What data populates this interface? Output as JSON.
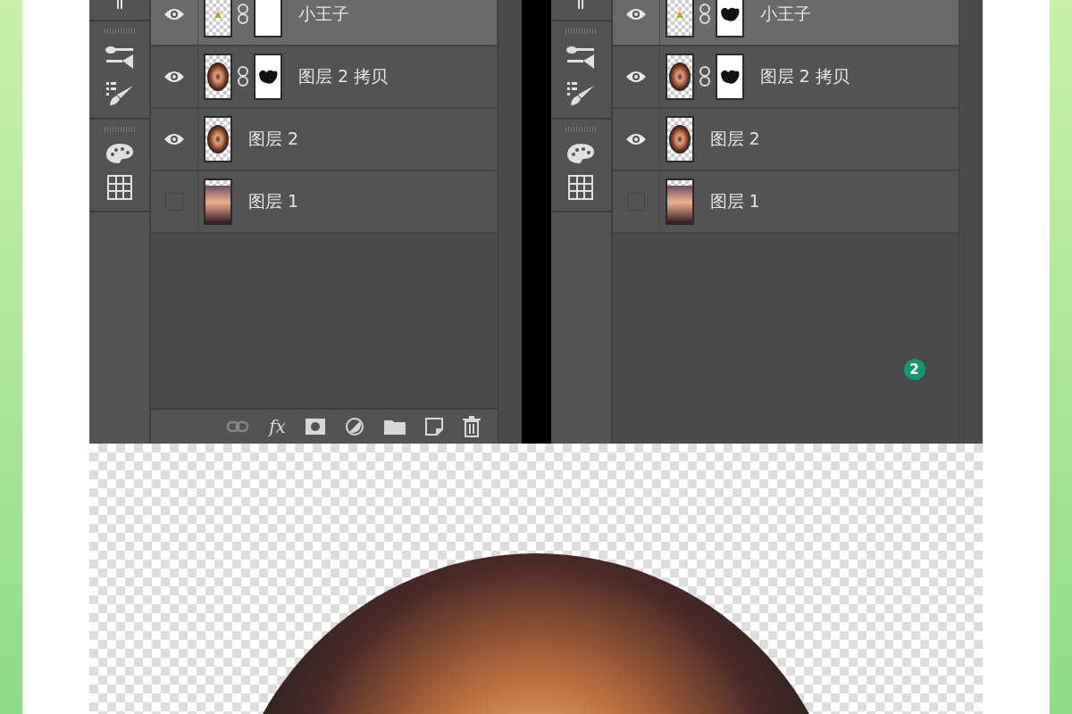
{
  "panels": [
    {
      "layers": [
        {
          "name": "小王子",
          "visible": true,
          "selected": true,
          "kind": "figure",
          "masked": true,
          "mask_empty": true
        },
        {
          "name": "图层 2 拷贝",
          "visible": true,
          "selected": false,
          "kind": "sphere",
          "masked": true,
          "mask_empty": false
        },
        {
          "name": "图层 2",
          "visible": true,
          "selected": false,
          "kind": "sphere",
          "masked": false
        },
        {
          "name": "图层 1",
          "visible": false,
          "selected": false,
          "kind": "sunset",
          "masked": false
        }
      ],
      "footer": {
        "fx_label": "fx"
      }
    },
    {
      "layers": [
        {
          "name": "小王子",
          "visible": true,
          "selected": true,
          "kind": "figure",
          "masked": true,
          "mask_empty": false
        },
        {
          "name": "图层 2 拷贝",
          "visible": true,
          "selected": false,
          "kind": "sphere",
          "masked": true,
          "mask_empty": false
        },
        {
          "name": "图层 2",
          "visible": true,
          "selected": false,
          "kind": "sphere",
          "masked": false
        },
        {
          "name": "图层 1",
          "visible": false,
          "selected": false,
          "kind": "sunset",
          "masked": false
        }
      ],
      "badge": "2"
    }
  ]
}
